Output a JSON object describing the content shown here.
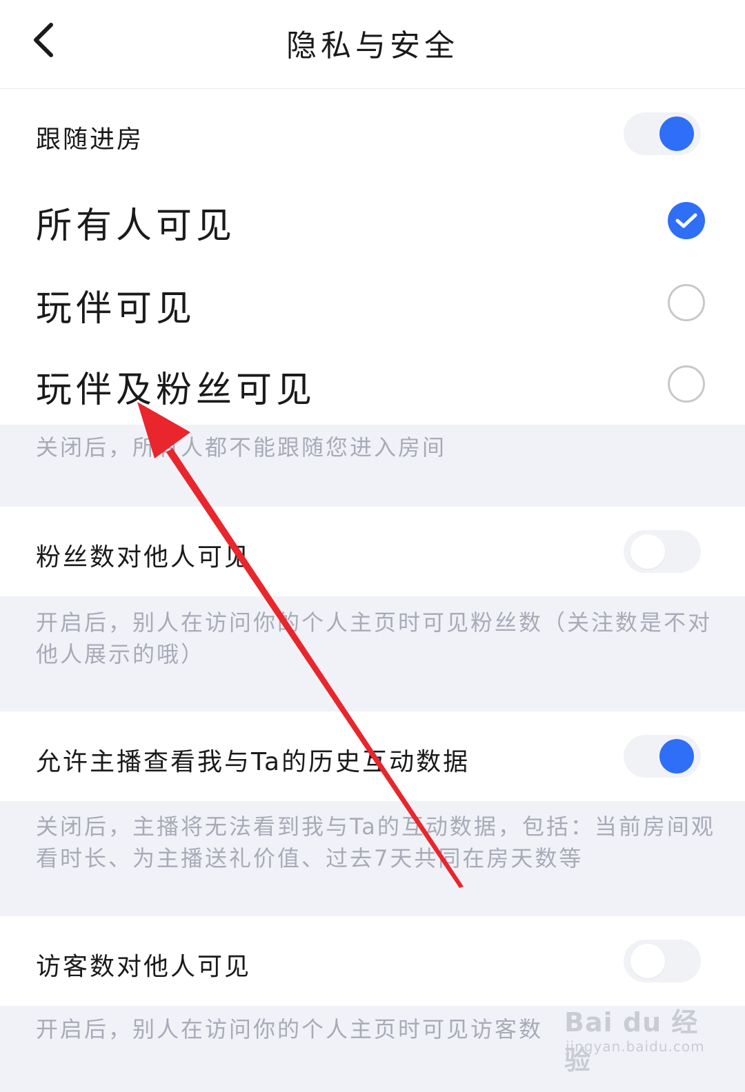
{
  "header": {
    "title": "隐私与安全",
    "back_icon": "chevron-left-icon"
  },
  "follow_room": {
    "label": "跟随进房",
    "toggle_on": true,
    "options": [
      {
        "label": "所有人可见",
        "selected": true
      },
      {
        "label": "玩伴可见",
        "selected": false
      },
      {
        "label": "玩伴及粉丝可见",
        "selected": false
      }
    ],
    "note": "关闭后，所有人都不能跟随您进入房间"
  },
  "fans_visible": {
    "label": "粉丝数对他人可见",
    "toggle_on": false,
    "note": "开启后，别人在访问你的个人主页时可见粉丝数（关注数是不对他人展示的哦）"
  },
  "history_data": {
    "label": "允许主播查看我与Ta的历史互动数据",
    "toggle_on": true,
    "note": "关闭后，主播将无法看到我与Ta的互动数据，包括：当前房间观看时长、为主播送礼价值、过去7天共同在房天数等"
  },
  "visitors_visible": {
    "label": "访客数对他人可见",
    "toggle_on": false,
    "note": "开启后，别人在访问你的个人主页时可见访客数"
  },
  "watermark": {
    "brand": "Bai du 经验",
    "url": "jingyan.baidu.com"
  },
  "colors": {
    "accent": "#2f6ef6",
    "annotation_arrow": "#e8262c",
    "section_bg": "#f1f2f8"
  }
}
